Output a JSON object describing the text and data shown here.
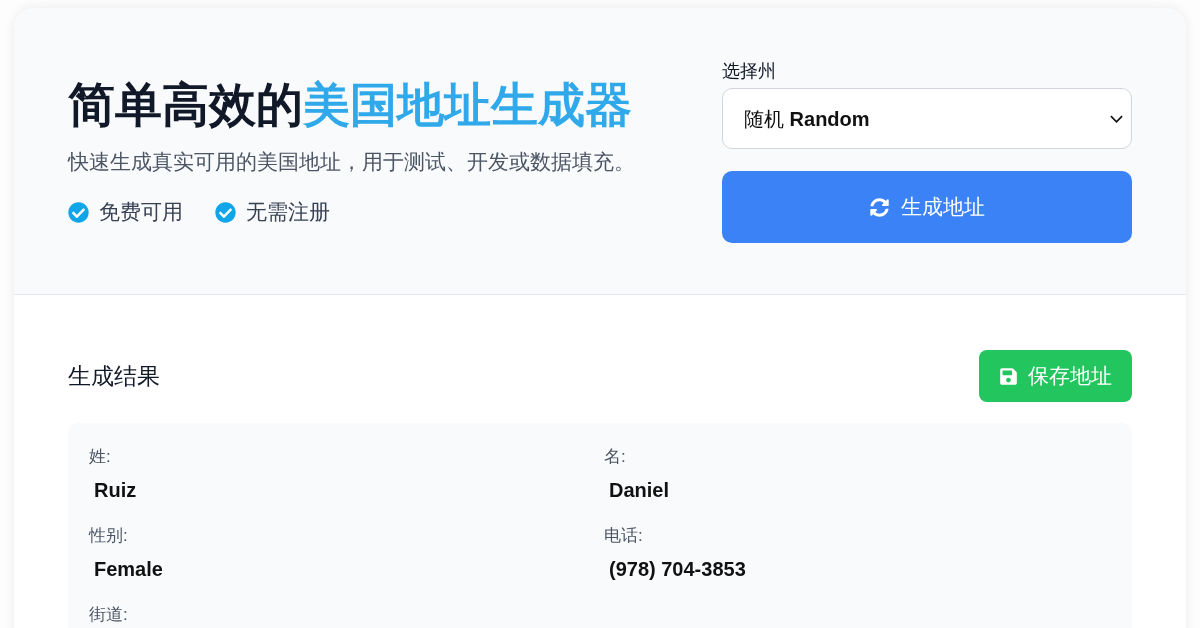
{
  "hero": {
    "title_plain": "简单高效的",
    "title_highlight": "美国地址生成器",
    "subtitle": "快速生成真实可用的美国地址，用于测试、开发或数据填充。",
    "features": [
      "免费可用",
      "无需注册"
    ]
  },
  "state_picker": {
    "label": "选择州",
    "value": "随机 **Random**"
  },
  "generate_button": {
    "label": "生成地址"
  },
  "results": {
    "title": "生成结果",
    "save_button": {
      "label": "保存地址"
    },
    "fields": [
      {
        "label": "姓:",
        "value": "Ruiz"
      },
      {
        "label": "名:",
        "value": "Daniel"
      },
      {
        "label": "性别:",
        "value": "Female"
      },
      {
        "label": "电话:",
        "value": "(978) 704-3853"
      },
      {
        "label": "街道:"
      }
    ]
  }
}
